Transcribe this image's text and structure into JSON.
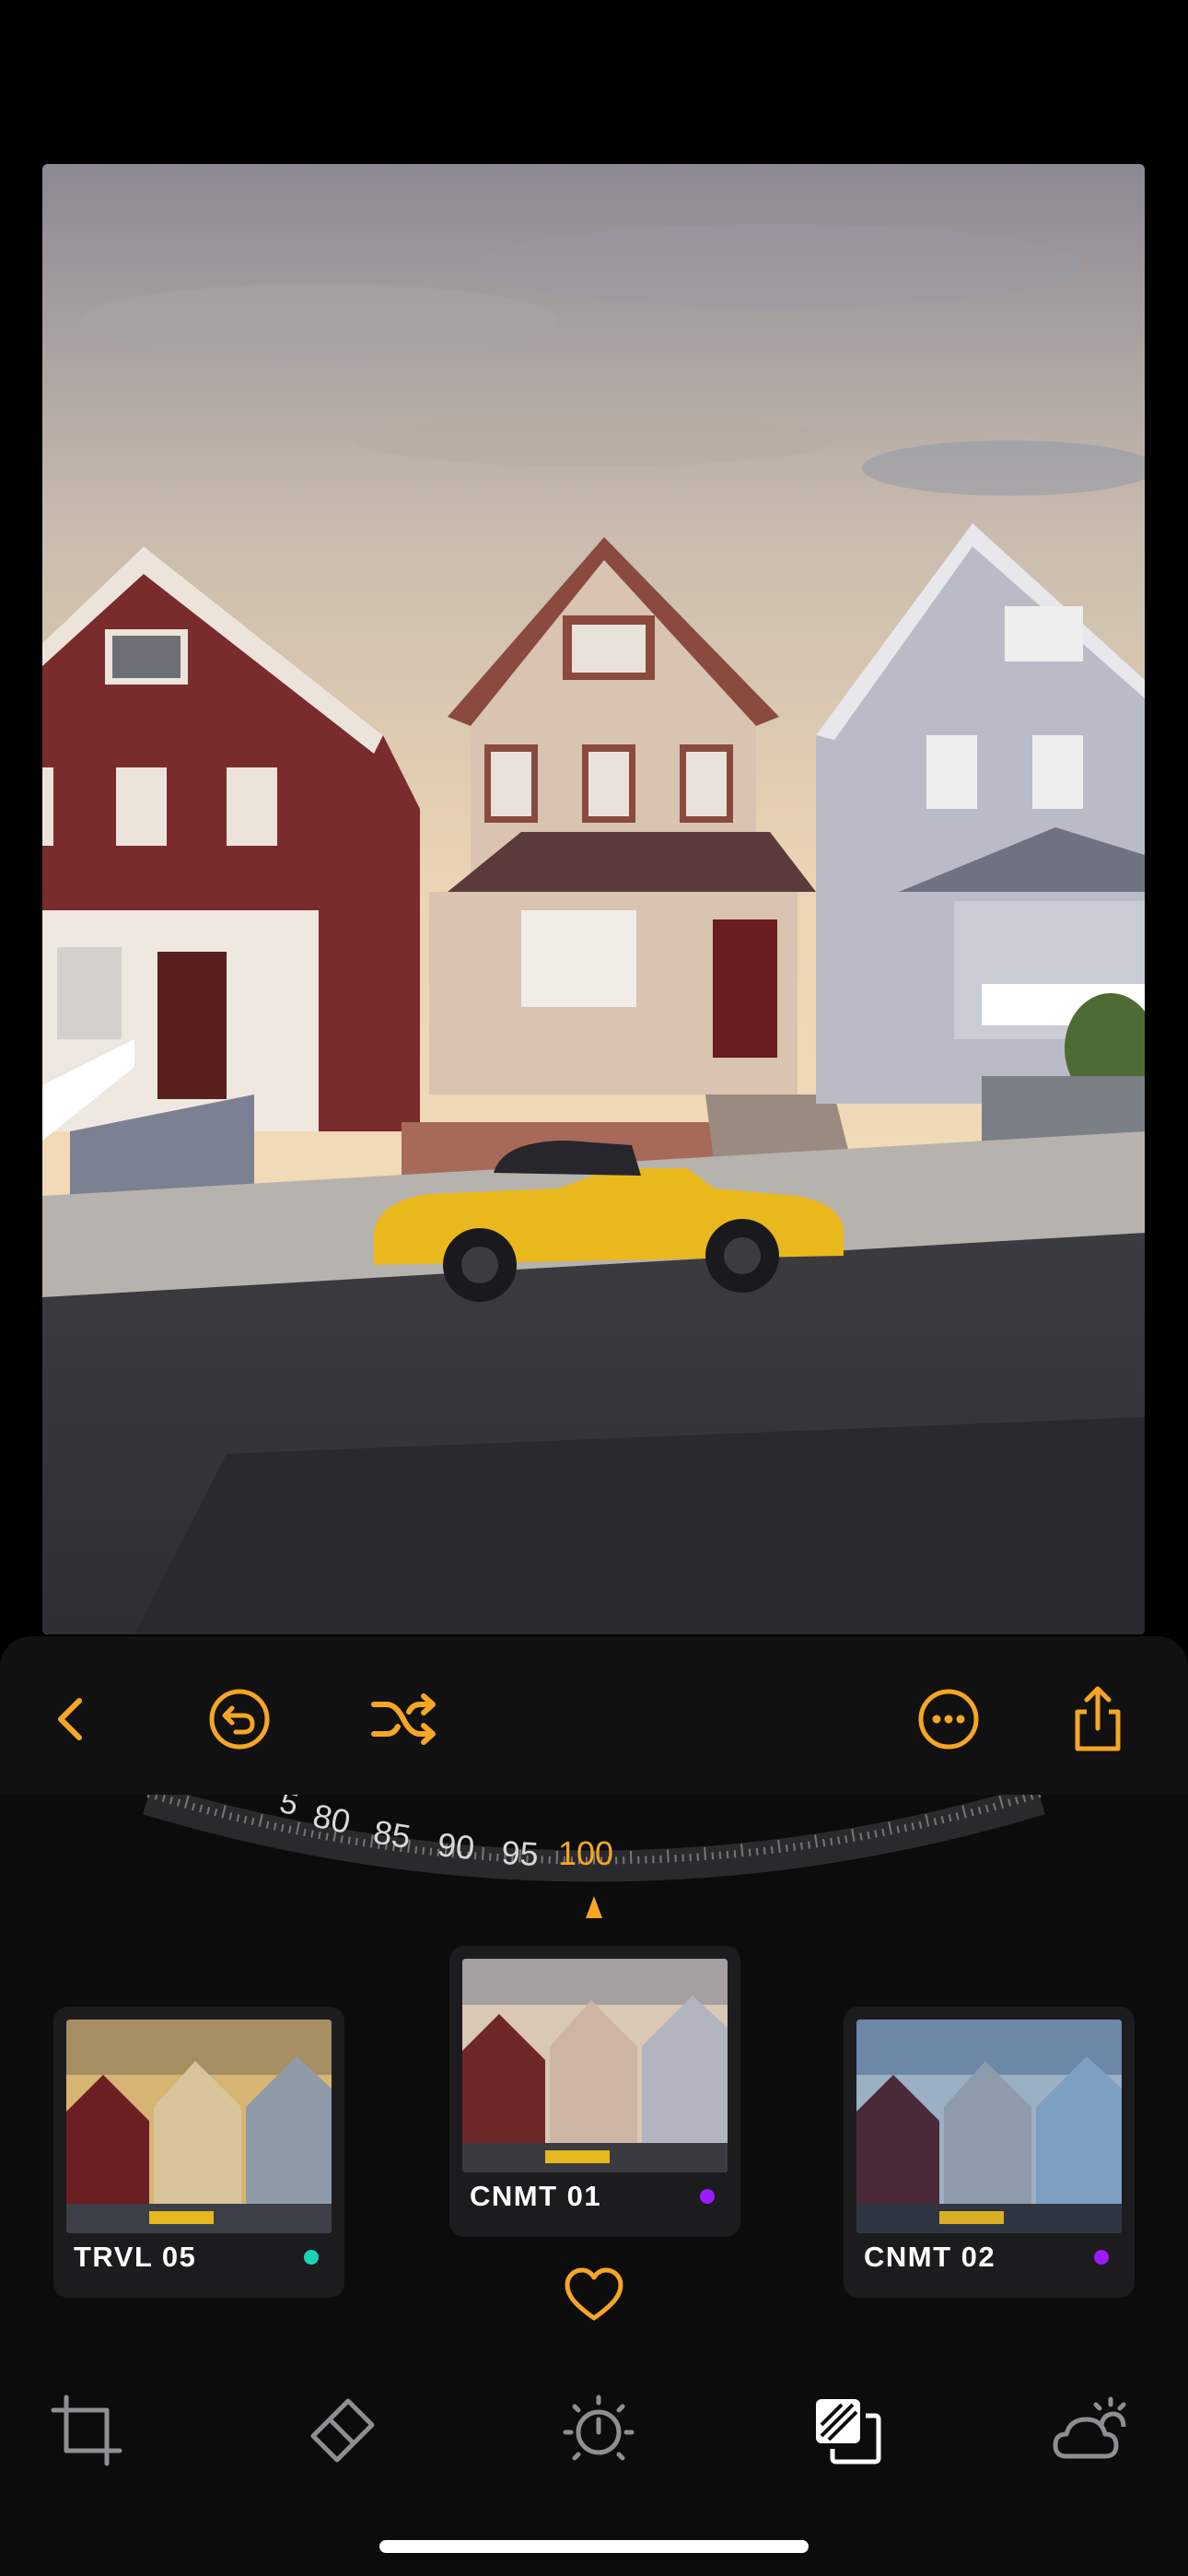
{
  "toolbar": {
    "back_icon": "chevron-left-icon",
    "undo_icon": "undo-circle-icon",
    "shuffle_icon": "shuffle-icon",
    "more_icon": "more-circle-icon",
    "share_icon": "share-icon",
    "accent_color": "#f5a623"
  },
  "dial": {
    "ticks": [
      "5",
      "80",
      "85",
      "90",
      "95",
      "100"
    ],
    "selected_value": "100"
  },
  "filters": [
    {
      "label": "TRVL 05",
      "dot_color": "#19d3b8",
      "selected": false
    },
    {
      "label": "CNMT 01",
      "dot_color": "#9b1aff",
      "selected": true
    },
    {
      "label": "CNMT 02",
      "dot_color": "#9b1aff",
      "selected": false
    }
  ],
  "favorite_icon": "heart-outline-icon",
  "tools": [
    {
      "name": "crop-icon",
      "active": false
    },
    {
      "name": "eraser-icon",
      "active": false
    },
    {
      "name": "exposure-dial-icon",
      "active": false
    },
    {
      "name": "filters-icon",
      "active": true
    },
    {
      "name": "weather-icon",
      "active": false
    }
  ]
}
